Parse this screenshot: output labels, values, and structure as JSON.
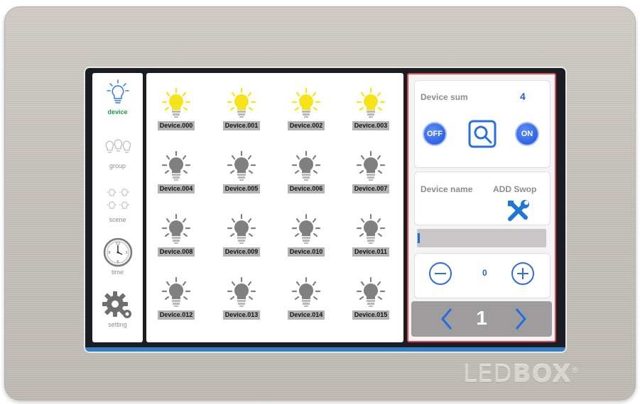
{
  "brand": {
    "part1": "LED",
    "part2": "BOX",
    "mark": "®"
  },
  "sidebar": {
    "items": [
      {
        "label": "device",
        "icon": "bulb-outline-icon",
        "active": true
      },
      {
        "label": "group",
        "icon": "bulb-group-icon",
        "active": false
      },
      {
        "label": "scene",
        "icon": "scene-bulbs-icon",
        "active": false
      },
      {
        "label": "time",
        "icon": "clock-icon",
        "active": false
      },
      {
        "label": "setting",
        "icon": "gear-icon",
        "active": false
      }
    ]
  },
  "devices": [
    {
      "name": "Device.000",
      "on": true
    },
    {
      "name": "Device.001",
      "on": true
    },
    {
      "name": "Device.002",
      "on": true
    },
    {
      "name": "Device.003",
      "on": true
    },
    {
      "name": "Device.004",
      "on": false
    },
    {
      "name": "Device.005",
      "on": false
    },
    {
      "name": "Device.006",
      "on": false
    },
    {
      "name": "Device.007",
      "on": false
    },
    {
      "name": "Device.008",
      "on": false
    },
    {
      "name": "Device.009",
      "on": false
    },
    {
      "name": "Device.010",
      "on": false
    },
    {
      "name": "Device.011",
      "on": false
    },
    {
      "name": "Device.012",
      "on": false
    },
    {
      "name": "Device.013",
      "on": false
    },
    {
      "name": "Device.014",
      "on": false
    },
    {
      "name": "Device.015",
      "on": false
    }
  ],
  "control": {
    "sum_label": "Device sum",
    "sum_value": "4",
    "off_label": "OFF",
    "on_label": "ON",
    "name_label": "Device name",
    "add_label": "ADD Swop",
    "level_value": "0",
    "level_fraction": 0.0,
    "page": "1"
  },
  "colors": {
    "bulb_on": "#f7e31a",
    "bulb_off": "#808080",
    "accent_blue": "#2f64e6",
    "panel_border": "#e0474f",
    "active_nav": "#1aa03a"
  }
}
